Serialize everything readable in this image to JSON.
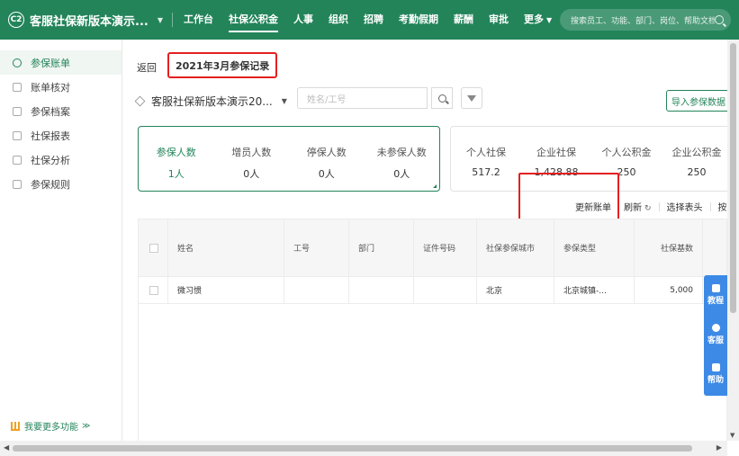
{
  "topbar": {
    "logo": "C2",
    "app_name": "客服社保新版本演示...",
    "nav": [
      {
        "label": "工作台"
      },
      {
        "label": "社保公积金"
      },
      {
        "label": "人事"
      },
      {
        "label": "组织"
      },
      {
        "label": "招聘"
      },
      {
        "label": "考勤假期"
      },
      {
        "label": "薪酬"
      },
      {
        "label": "审批"
      },
      {
        "label": "更多"
      }
    ],
    "search_placeholder": "搜索员工、功能、部门、岗位、帮助文档"
  },
  "sidebar": {
    "items": [
      {
        "label": "参保账单"
      },
      {
        "label": "账单核对"
      },
      {
        "label": "参保档案"
      },
      {
        "label": "社保报表"
      },
      {
        "label": "社保分析"
      },
      {
        "label": "参保规则"
      }
    ],
    "more_label": "我要更多功能"
  },
  "main": {
    "back_label": "返回",
    "page_title": "2021年3月参保记录",
    "company": "客服社保新版本演示20...",
    "search_placeholder": "姓名/工号",
    "import_label": "导入参保数据",
    "stats": [
      {
        "label": "参保人数",
        "value": "1人"
      },
      {
        "label": "增员人数",
        "value": "0人"
      },
      {
        "label": "停保人数",
        "value": "0人"
      },
      {
        "label": "未参保人数",
        "value": "0人"
      }
    ],
    "money": [
      {
        "label": "个人社保",
        "value": "517.2"
      },
      {
        "label": "企业社保",
        "value": "1,428.88"
      },
      {
        "label": "个人公积金",
        "value": "250"
      },
      {
        "label": "企业公积金",
        "value": "250"
      }
    ],
    "actions": {
      "update": "更新账单",
      "refresh": "刷新",
      "choose_header": "选择表头",
      "more": "按"
    },
    "table": {
      "headers": [
        "姓名",
        "工号",
        "部门",
        "证件号码",
        "社保参保城市",
        "参保类型",
        "社保基数"
      ],
      "rows": [
        {
          "name": "微习惯",
          "no": "",
          "dept": "",
          "id": "",
          "city": "北京",
          "type": "北京城镇-...",
          "base": "5,000"
        }
      ]
    }
  },
  "helpbar": [
    {
      "label": "教程",
      "icon": "book-icon"
    },
    {
      "label": "客服",
      "icon": "chat-icon"
    },
    {
      "label": "帮助",
      "icon": "doc-icon"
    }
  ]
}
